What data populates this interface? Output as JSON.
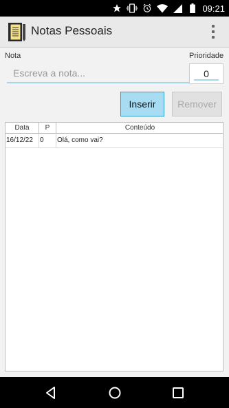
{
  "status_bar": {
    "time": "09:21",
    "icons": [
      "star-icon",
      "vibrate-icon",
      "alarm-icon",
      "wifi-icon",
      "signal-icon",
      "battery-icon"
    ]
  },
  "app_bar": {
    "title": "Notas Pessoais",
    "icon": "notepad-icon",
    "menu_icon": "overflow-menu-icon"
  },
  "form": {
    "note_label": "Nota",
    "note_placeholder": "Escreva a nota...",
    "note_value": "",
    "priority_label": "Prioridade",
    "priority_value": "0"
  },
  "buttons": {
    "insert_label": "Inserir",
    "remove_label": "Remover"
  },
  "table": {
    "columns": [
      "Data",
      "P",
      "Conteúdo"
    ],
    "rows": [
      [
        "16/12/22",
        "0",
        "Olá, como vai?"
      ]
    ]
  },
  "nav_bar": {
    "icons": [
      "back-icon",
      "home-icon",
      "recents-icon"
    ]
  },
  "colors": {
    "insert_button_bg": "#a7dcf2",
    "insert_button_border": "#2f9bc9",
    "input_underline": "#a6d6ea"
  }
}
